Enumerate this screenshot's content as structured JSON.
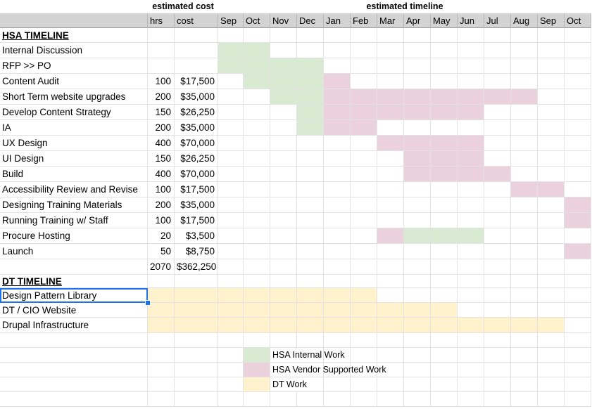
{
  "group_headers": {
    "estimated_cost": "estimated cost",
    "estimated_timeline": "estimated timeline"
  },
  "column_headers": {
    "hrs": "hrs",
    "cost": "cost",
    "months": [
      "Sep",
      "Oct",
      "Nov",
      "Dec",
      "Jan",
      "Feb",
      "Mar",
      "Apr",
      "May",
      "Jun",
      "Jul",
      "Aug",
      "Sep",
      "Oct"
    ]
  },
  "hsa_section": {
    "title": "HSA TIMELINE",
    "tasks": [
      {
        "name": "Internal Discussion",
        "hrs": "",
        "cost": "",
        "bars": [
          {
            "start": 0,
            "end": 1,
            "type": "internal"
          }
        ]
      },
      {
        "name": "RFP >> PO",
        "hrs": "",
        "cost": "",
        "bars": [
          {
            "start": 0,
            "end": 3,
            "type": "internal"
          }
        ]
      },
      {
        "name": "Content Audit",
        "hrs": "100",
        "cost": "$17,500",
        "bars": [
          {
            "start": 1,
            "end": 3,
            "type": "internal"
          },
          {
            "start": 4,
            "end": 4,
            "type": "vendor"
          }
        ]
      },
      {
        "name": "Short Term website upgrades",
        "hrs": "200",
        "cost": "$35,000",
        "bars": [
          {
            "start": 2,
            "end": 3,
            "type": "internal"
          },
          {
            "start": 4,
            "end": 11,
            "type": "vendor"
          }
        ]
      },
      {
        "name": "Develop Content Strategy",
        "hrs": "150",
        "cost": "$26,250",
        "bars": [
          {
            "start": 3,
            "end": 3,
            "type": "internal"
          },
          {
            "start": 4,
            "end": 9,
            "type": "vendor"
          }
        ]
      },
      {
        "name": "IA",
        "hrs": "200",
        "cost": "$35,000",
        "bars": [
          {
            "start": 3,
            "end": 3,
            "type": "internal"
          },
          {
            "start": 4,
            "end": 5,
            "type": "vendor"
          }
        ]
      },
      {
        "name": "UX Design",
        "hrs": "400",
        "cost": "$70,000",
        "bars": [
          {
            "start": 6,
            "end": 9,
            "type": "vendor"
          }
        ]
      },
      {
        "name": "UI Design",
        "hrs": "150",
        "cost": "$26,250",
        "bars": [
          {
            "start": 7,
            "end": 9,
            "type": "vendor"
          }
        ]
      },
      {
        "name": "Build",
        "hrs": "400",
        "cost": "$70,000",
        "bars": [
          {
            "start": 7,
            "end": 10,
            "type": "vendor"
          }
        ]
      },
      {
        "name": "Accessibility Review and Revise",
        "hrs": "100",
        "cost": "$17,500",
        "bars": [
          {
            "start": 11,
            "end": 12,
            "type": "vendor"
          }
        ]
      },
      {
        "name": "Designing Training Materials",
        "hrs": "200",
        "cost": "$35,000",
        "bars": [
          {
            "start": 13,
            "end": 13,
            "type": "vendor"
          }
        ]
      },
      {
        "name": "Running Training w/ Staff",
        "hrs": "100",
        "cost": "$17,500",
        "bars": [
          {
            "start": 13,
            "end": 13,
            "type": "vendor"
          }
        ]
      },
      {
        "name": "Procure Hosting",
        "hrs": "20",
        "cost": "$3,500",
        "bars": [
          {
            "start": 6,
            "end": 6,
            "type": "vendor"
          },
          {
            "start": 7,
            "end": 9,
            "type": "internal"
          }
        ]
      },
      {
        "name": "Launch",
        "hrs": "50",
        "cost": "$8,750",
        "bars": [
          {
            "start": 13,
            "end": 13,
            "type": "vendor"
          }
        ]
      }
    ],
    "total_hrs": "2070",
    "total_cost": "$362,250"
  },
  "dt_section": {
    "title": "DT TIMELINE",
    "tasks": [
      {
        "name": "Design Pattern Library",
        "bars": [
          {
            "start": 0,
            "end": 5,
            "type": "dt"
          }
        ]
      },
      {
        "name": "DT / CIO Website",
        "bars": [
          {
            "start": 0,
            "end": 8,
            "type": "dt"
          }
        ]
      },
      {
        "name": "Drupal Infrastructure",
        "bars": [
          {
            "start": 0,
            "end": 12,
            "type": "dt"
          }
        ]
      }
    ]
  },
  "legend": [
    {
      "label": "HSA Internal Work",
      "type": "internal"
    },
    {
      "label": "HSA Vendor Supported Work",
      "type": "vendor"
    },
    {
      "label": "DT Work",
      "type": "dt"
    }
  ],
  "colors": {
    "internal": "#d9ead3",
    "vendor": "#ead1dc",
    "dt": "#fff2cc",
    "header": "#d3d3d3",
    "selection": "#1a73e8"
  },
  "selected_cell": "Design Pattern Library"
}
